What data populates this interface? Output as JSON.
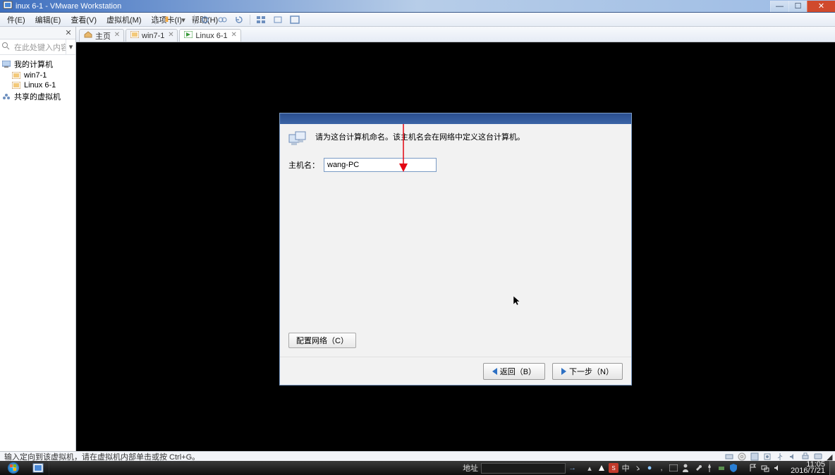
{
  "window": {
    "title": "inux 6-1 - VMware Workstation"
  },
  "menu": {
    "file": "件(E)",
    "edit": "编辑(E)",
    "view": "查看(V)",
    "vm": "虚拟机(M)",
    "tabs": "选项卡(I)",
    "help": "帮助(H)"
  },
  "sidebar": {
    "search_placeholder": "在此处键入内容进行…",
    "root": "我的计算机",
    "items": [
      {
        "label": "win7-1"
      },
      {
        "label": "Linux 6-1"
      }
    ],
    "shared": "共享的虚拟机"
  },
  "tabs": [
    {
      "label": "主页",
      "kind": "home",
      "active": false
    },
    {
      "label": "win7-1",
      "kind": "vm",
      "active": false
    },
    {
      "label": "Linux 6-1",
      "kind": "vm",
      "active": true
    }
  ],
  "dialog": {
    "message": "请为这台计算机命名。该主机名会在网络中定义这台计算机。",
    "hostname_label": "主机名：",
    "hostname_value": "wang-PC",
    "configure_net": "配置网络（C）",
    "back": "返回（B）",
    "next": "下一步（N）"
  },
  "statusbar": {
    "hint": "输入定向到该虚拟机，请在虚拟机内部单击或按 Ctrl+G。"
  },
  "taskbar": {
    "address_label": "地址",
    "time": "11:05",
    "date": "2016/7/21"
  }
}
